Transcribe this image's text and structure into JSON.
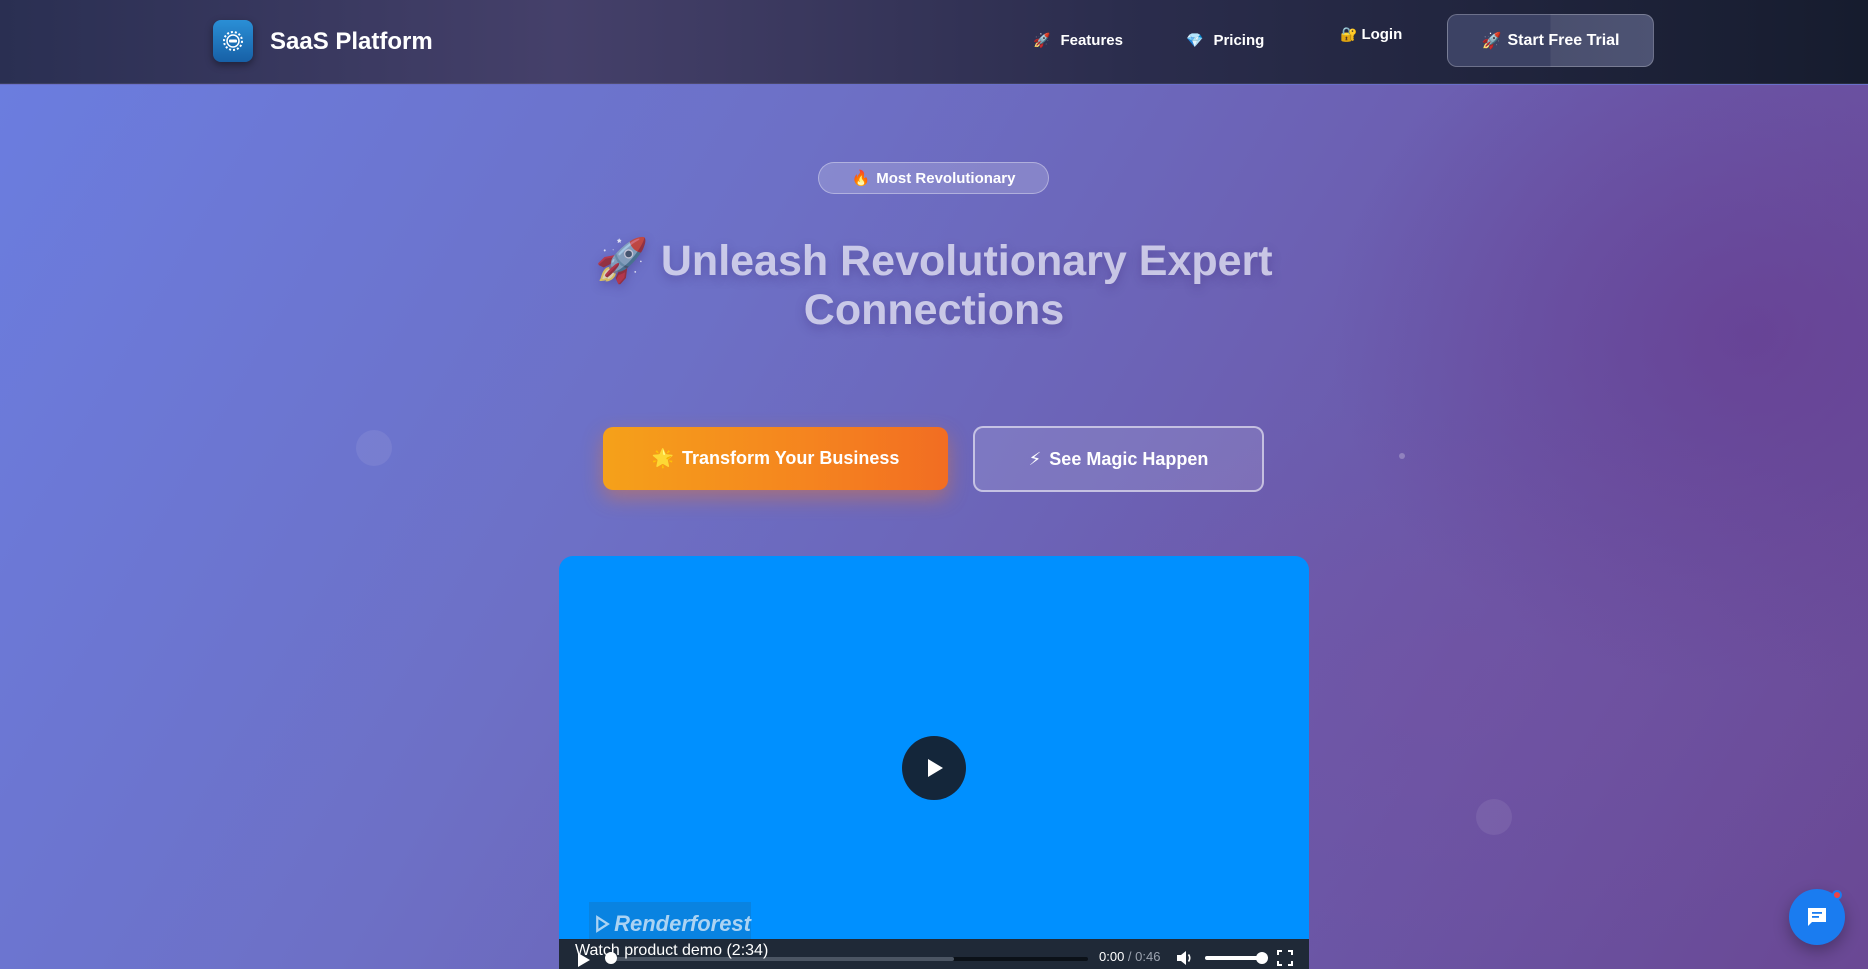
{
  "header": {
    "brand": "SaaS Platform",
    "logo_icon": "gear-icon",
    "nav": [
      {
        "emoji": "🚀",
        "label": "Features"
      },
      {
        "emoji": "💎",
        "label": "Pricing"
      },
      {
        "emoji": "🔐",
        "label": "Login"
      }
    ],
    "cta": {
      "emoji": "🚀",
      "label": "Start Free Trial"
    }
  },
  "hero": {
    "badge": {
      "emoji": "🔥",
      "label": "Most Revolutionary"
    },
    "headline": "🚀 Unleash Revolutionary Expert Connections",
    "primary_button": {
      "emoji": "🌟",
      "label": "Transform Your Business"
    },
    "secondary_button": {
      "emoji": "⚡",
      "label": "See Magic Happen"
    }
  },
  "video": {
    "watermark": "Renderforest",
    "caption": "Watch product demo (2:34)",
    "current_time": "0:00",
    "separator": " / ",
    "duration": "0:46",
    "progress_buffered": 0.72,
    "volume": 1.0,
    "background": "#0090ff"
  },
  "chat": {
    "icon": "chat-bubble-icon",
    "unread_dot": true
  },
  "colors": {
    "accent_orange": "#f5841f",
    "chat_blue": "#1a7cf0"
  }
}
